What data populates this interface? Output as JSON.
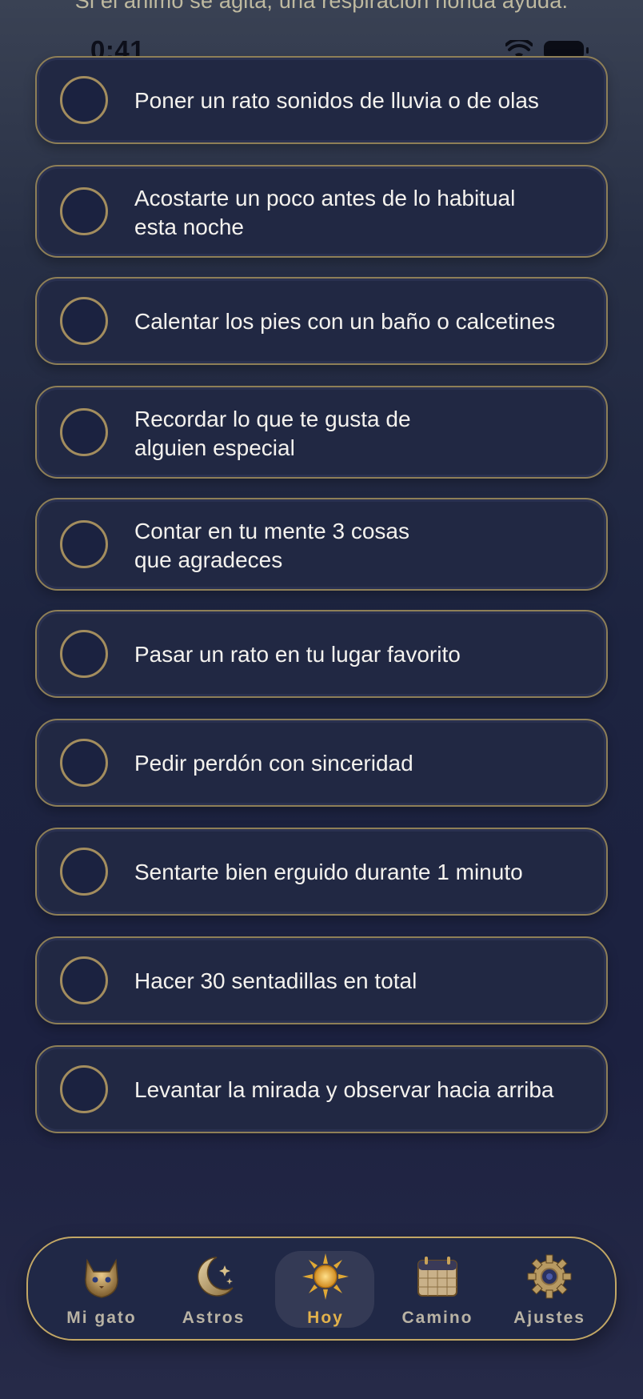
{
  "header": {
    "subtitle": "Si el ánimo se agita, una respiración honda ayuda."
  },
  "status_bar": {
    "time": "0:41"
  },
  "tasks": [
    {
      "label": "Poner un rato sonidos de lluvia o de olas",
      "done": false
    },
    {
      "label": "Acostarte un poco antes de lo habitual\nesta noche",
      "done": false
    },
    {
      "label": "Calentar los pies con un baño o calcetines",
      "done": false
    },
    {
      "label": "Recordar lo que te gusta de\nalguien especial",
      "done": false
    },
    {
      "label": "Contar en tu mente 3 cosas\nque agradeces",
      "done": false
    },
    {
      "label": "Pasar un rato en tu lugar favorito",
      "done": false
    },
    {
      "label": "Pedir perdón con sinceridad",
      "done": false
    },
    {
      "label": "Sentarte bien erguido durante 1 minuto",
      "done": false
    },
    {
      "label": "Hacer 30 sentadillas en total",
      "done": false
    },
    {
      "label": "Levantar la mirada y observar hacia arriba",
      "done": false
    }
  ],
  "tabbar": {
    "items": [
      {
        "label": "Mi gato",
        "icon": "cat-icon",
        "active": false
      },
      {
        "label": "Astros",
        "icon": "moon-stars-icon",
        "active": false
      },
      {
        "label": "Hoy",
        "icon": "sun-icon",
        "active": true
      },
      {
        "label": "Camino",
        "icon": "calendar-icon",
        "active": false
      },
      {
        "label": "Ajustes",
        "icon": "gear-icon",
        "active": false
      }
    ]
  },
  "colors": {
    "accent_gold": "#c2a765",
    "card_bg": "#212843",
    "active_label": "#e3b24b"
  }
}
